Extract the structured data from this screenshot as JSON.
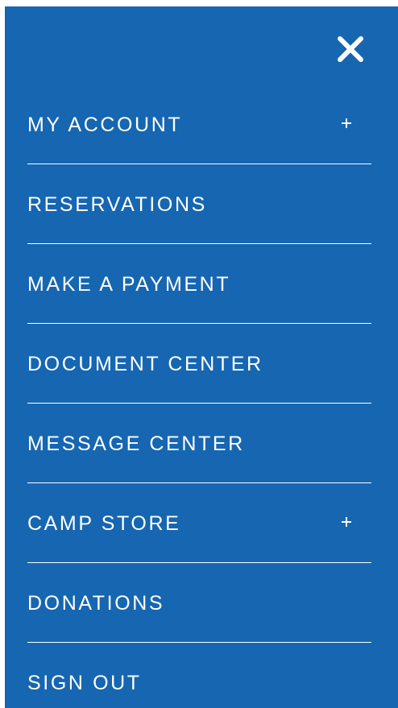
{
  "header": {
    "close_icon": "close-icon"
  },
  "menu": {
    "items": [
      {
        "label": "MY ACCOUNT",
        "expandable": true,
        "expand_icon": "plus-icon"
      },
      {
        "label": "RESERVATIONS",
        "expandable": false
      },
      {
        "label": "MAKE A PAYMENT",
        "expandable": false
      },
      {
        "label": "DOCUMENT CENTER",
        "expandable": false
      },
      {
        "label": "MESSAGE CENTER",
        "expandable": false
      },
      {
        "label": "CAMP STORE",
        "expandable": true,
        "expand_icon": "plus-icon"
      },
      {
        "label": "DONATIONS",
        "expandable": false
      },
      {
        "label": "SIGN OUT",
        "expandable": false
      }
    ]
  },
  "colors": {
    "panel_background": "#1666b1",
    "text": "#ffffff",
    "divider": "#ffffff"
  }
}
